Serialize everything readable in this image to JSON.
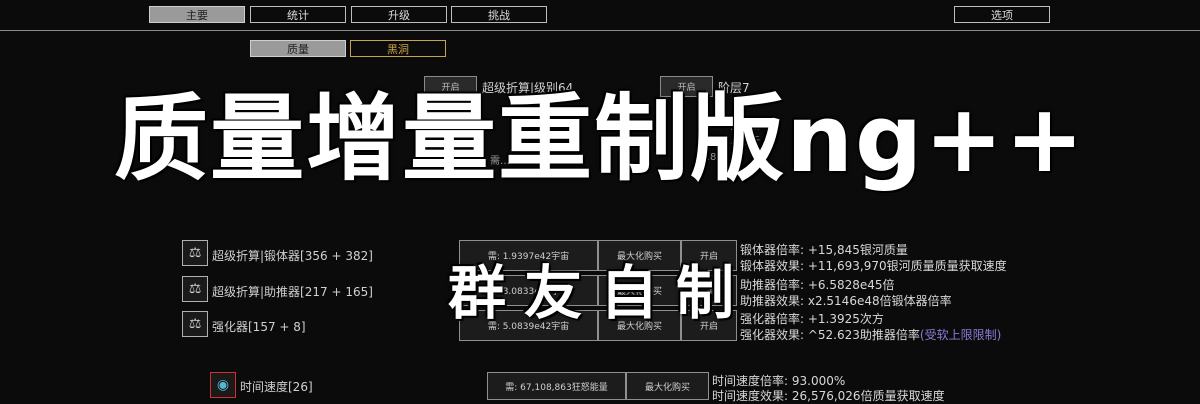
{
  "nav": {
    "tabs": [
      "主要",
      "统计",
      "升级",
      "挑战"
    ],
    "options_label": "选项"
  },
  "subtabs": [
    "质量",
    "黑洞"
  ],
  "top_panel": {
    "left_button": "开启",
    "left_title": "超级折算|级别64",
    "left_desc_1": "需要…",
    "left_desc_2": "…的奖励",
    "left_req": "需…42宇宙",
    "right_button": "开启",
    "right_title": "阶层7",
    "right_desc_1": "…在…",
    "right_desc_2": "…基于…",
    "right_req": "…81"
  },
  "upgrades": [
    {
      "icon": "weight-icon",
      "label": "超级折算|锻体器[356 + 382]",
      "cost": "需: 1.9397e42宇宙",
      "buy_max": "最大化购买",
      "toggle": "开启",
      "stat1": "锻体器倍率: +15,845银河质量",
      "stat2": "锻体器效果: +11,693,970银河质量质量获取速度"
    },
    {
      "icon": "weight-icon",
      "label": "超级折算|助推器[217 + 165]",
      "cost": "需: 3.0833e42宇宙",
      "buy_max": "最大化购买",
      "toggle": "开启",
      "stat1": "助推器倍率: +6.5828e45倍",
      "stat2": "助推器效果: x2.5146e48倍锻体器倍率"
    },
    {
      "icon": "weight-icon",
      "label": "强化器[157 + 8]",
      "cost": "需: 5.0839e42宇宙",
      "buy_max": "最大化购买",
      "toggle": "开启",
      "stat1": "强化器倍率: +1.3925次方",
      "stat2": "强化器效果: ^52.623助推器倍率",
      "note": "(受软上限限制)"
    }
  ],
  "time_speed": {
    "icon": "clock-icon",
    "label": "时间速度[26]",
    "cost": "需: 67,108,863狂怒能量",
    "buy_max": "最大化购买",
    "stat1": "时间速度倍率: 93.000%",
    "stat2": "时间速度效果: 26,576,026倍质量获取速度"
  },
  "overlay": {
    "title": "质量增量重制版ng++",
    "subtitle": "群友自制"
  },
  "colors": {
    "background": "#0b0b0b",
    "active_tab": "#9a9a9a",
    "gold_border": "#c9a24a",
    "note_purple": "#8d7ad8",
    "icon_red_border": "#d03030"
  }
}
